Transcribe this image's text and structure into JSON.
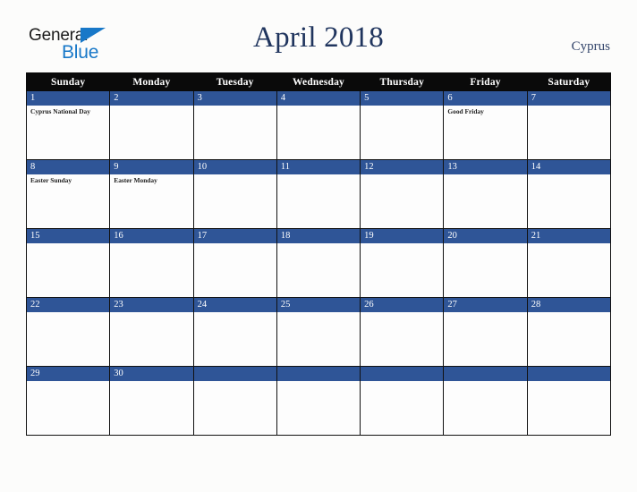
{
  "brand": {
    "name_part1": "General",
    "name_part2": "Blue",
    "triangle_color": "#1878c8"
  },
  "header": {
    "title": "April 2018",
    "country": "Cyprus",
    "title_color": "#20355e"
  },
  "calendar": {
    "weekday_headers": [
      "Sunday",
      "Monday",
      "Tuesday",
      "Wednesday",
      "Thursday",
      "Friday",
      "Saturday"
    ],
    "header_bg": "#0a0a0a",
    "date_band_color": "#2f5597",
    "weeks": [
      [
        {
          "date": "1",
          "events": [
            "Cyprus National Day"
          ]
        },
        {
          "date": "2",
          "events": []
        },
        {
          "date": "3",
          "events": []
        },
        {
          "date": "4",
          "events": []
        },
        {
          "date": "5",
          "events": []
        },
        {
          "date": "6",
          "events": [
            "Good Friday"
          ]
        },
        {
          "date": "7",
          "events": []
        }
      ],
      [
        {
          "date": "8",
          "events": [
            "Easter Sunday"
          ]
        },
        {
          "date": "9",
          "events": [
            "Easter Monday"
          ]
        },
        {
          "date": "10",
          "events": []
        },
        {
          "date": "11",
          "events": []
        },
        {
          "date": "12",
          "events": []
        },
        {
          "date": "13",
          "events": []
        },
        {
          "date": "14",
          "events": []
        }
      ],
      [
        {
          "date": "15",
          "events": []
        },
        {
          "date": "16",
          "events": []
        },
        {
          "date": "17",
          "events": []
        },
        {
          "date": "18",
          "events": []
        },
        {
          "date": "19",
          "events": []
        },
        {
          "date": "20",
          "events": []
        },
        {
          "date": "21",
          "events": []
        }
      ],
      [
        {
          "date": "22",
          "events": []
        },
        {
          "date": "23",
          "events": []
        },
        {
          "date": "24",
          "events": []
        },
        {
          "date": "25",
          "events": []
        },
        {
          "date": "26",
          "events": []
        },
        {
          "date": "27",
          "events": []
        },
        {
          "date": "28",
          "events": []
        }
      ],
      [
        {
          "date": "29",
          "events": []
        },
        {
          "date": "30",
          "events": []
        },
        {
          "date": "",
          "events": []
        },
        {
          "date": "",
          "events": []
        },
        {
          "date": "",
          "events": []
        },
        {
          "date": "",
          "events": []
        },
        {
          "date": "",
          "events": []
        }
      ]
    ]
  }
}
